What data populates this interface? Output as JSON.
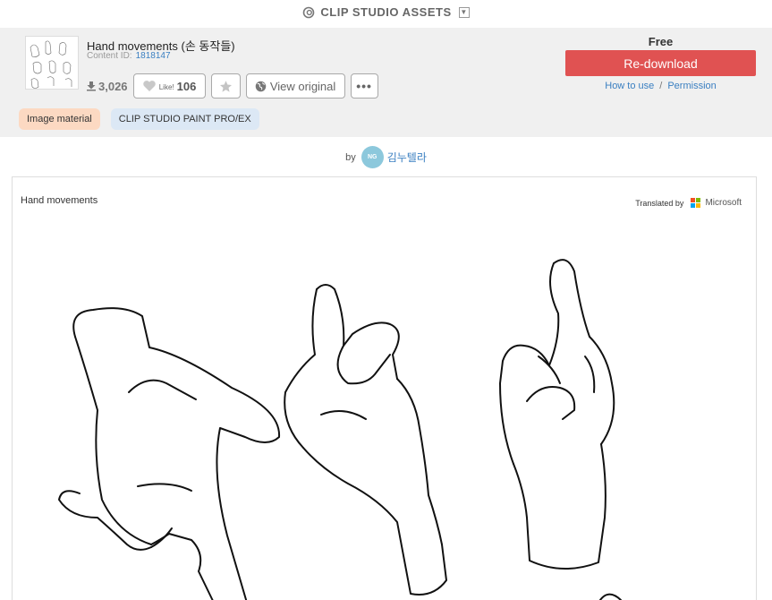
{
  "topbar": {
    "brand": "CLIP STUDIO ASSETS"
  },
  "asset": {
    "title": "Hand movements (손 동작들)",
    "content_id_label": "Content ID:",
    "content_id": "1818147",
    "downloads": "3,026",
    "like_label": "Like!",
    "like_count": "106",
    "view_original": "View original",
    "more_glyph": "•••"
  },
  "purchase": {
    "price": "Free",
    "button": "Re-download",
    "how_to_use": "How to use",
    "separator": "/",
    "permission": "Permission"
  },
  "tags": {
    "type": "Image material",
    "software": "CLIP STUDIO PAINT PRO/EX"
  },
  "byline": {
    "by": "by",
    "avatar_text": "NG",
    "author": "김누텔라"
  },
  "content": {
    "description": "Hand movements",
    "translated_by": "Translated by",
    "translator": "Microsoft"
  },
  "colors": {
    "accent": "#e05252",
    "link": "#3a7fc1",
    "tag_image": "#fcd9c2",
    "tag_software": "#dce8f5",
    "header_bg": "#f0f0f0"
  },
  "icons": [
    "clip-studio-logo-icon",
    "dropdown-icon",
    "download-icon",
    "heart-icon",
    "star-icon",
    "globe-icon",
    "microsoft-logo-icon"
  ]
}
